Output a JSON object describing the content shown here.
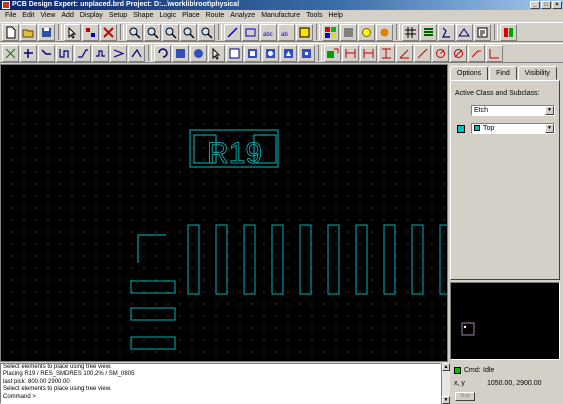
{
  "window": {
    "title": "PCB Design Expert: unplaced.brd  Project: D:...\\worklib\\root\\physical",
    "minimize": "_",
    "maximize": "□",
    "close": "×"
  },
  "menu": [
    "File",
    "Edit",
    "View",
    "Add",
    "Display",
    "Setup",
    "Shape",
    "Logic",
    "Place",
    "Route",
    "Analyze",
    "Manufacture",
    "Tools",
    "Help"
  ],
  "canvas": {
    "refdes": "R19",
    "colors": {
      "background": "#000000",
      "outline": "#00c0c0",
      "pad": "#00b0b0",
      "grid": "#5a5a5a"
    }
  },
  "panel": {
    "tabs": [
      "Options",
      "Find",
      "Visibility"
    ],
    "active_tab": "Options",
    "active_class_label": "Active Class and Subclass:",
    "class_value": "Etch",
    "subclass_value": "Top",
    "subclass_color": "#00c0c0",
    "dropdown_arrow": "▼"
  },
  "console": {
    "lines": [
      "Select elements to place using tree view.",
      "Placing R19 / RES_SMDRES 100,2% / SM_0805",
      "last pick:  800.00  2900.00",
      "Select elements to place using tree view.",
      "Command >"
    ],
    "scroll_up": "▲",
    "scroll_down": "▼"
  },
  "status": {
    "cmd_label": "Cmd:",
    "cmd_state": "Idle",
    "coord_label": "x, y",
    "coordinates": "1050.00, 2900.00",
    "button_label": "Stop"
  }
}
